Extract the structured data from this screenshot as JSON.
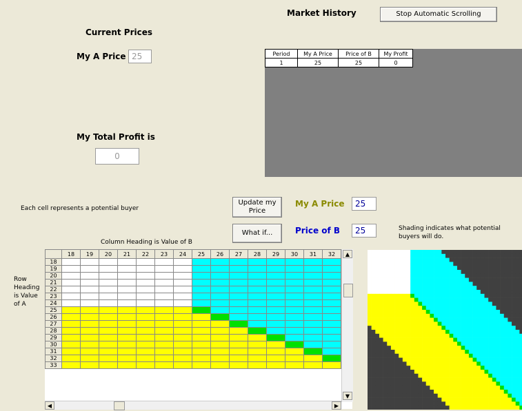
{
  "top": {
    "market_history_label": "Market History",
    "stop_scrolling_label": "Stop Automatic Scrolling",
    "current_prices_label": "Current Prices",
    "my_a_price_label": "My A Price",
    "my_a_price_value": "25",
    "total_profit_label": "My Total Profit is",
    "total_profit_value": "0"
  },
  "history": {
    "headers": [
      "Period",
      "My A Price",
      "Price of B",
      "My Profit"
    ],
    "rows": [
      [
        "1",
        "25",
        "25",
        "0"
      ]
    ]
  },
  "controls": {
    "buyer_note": "Each cell represents a potential buyer",
    "update_price_label": "Update my Price",
    "what_if_label": "What if...",
    "a_price_label": "My A Price",
    "a_price_value": "25",
    "b_price_label": "Price of B",
    "b_price_value": "25",
    "shading_note": "Shading indicates what potential buyers will do.",
    "column_heading_note": "Column Heading is Value of B",
    "row_heading_note": "Row Heading is Value of A"
  },
  "grid": {
    "col_headers": [
      "18",
      "19",
      "20",
      "21",
      "22",
      "23",
      "24",
      "25",
      "26",
      "27",
      "28",
      "29",
      "30",
      "31",
      "32"
    ],
    "row_headers": [
      "18",
      "19",
      "20",
      "21",
      "22",
      "23",
      "24",
      "25",
      "26",
      "27",
      "28",
      "29",
      "30",
      "31",
      "32",
      "33"
    ],
    "colors": {
      "white": "#ffffff",
      "cyan": "#00ffff",
      "yellow": "#ffff00",
      "green": "#00e000",
      "dark": "#404040"
    }
  }
}
